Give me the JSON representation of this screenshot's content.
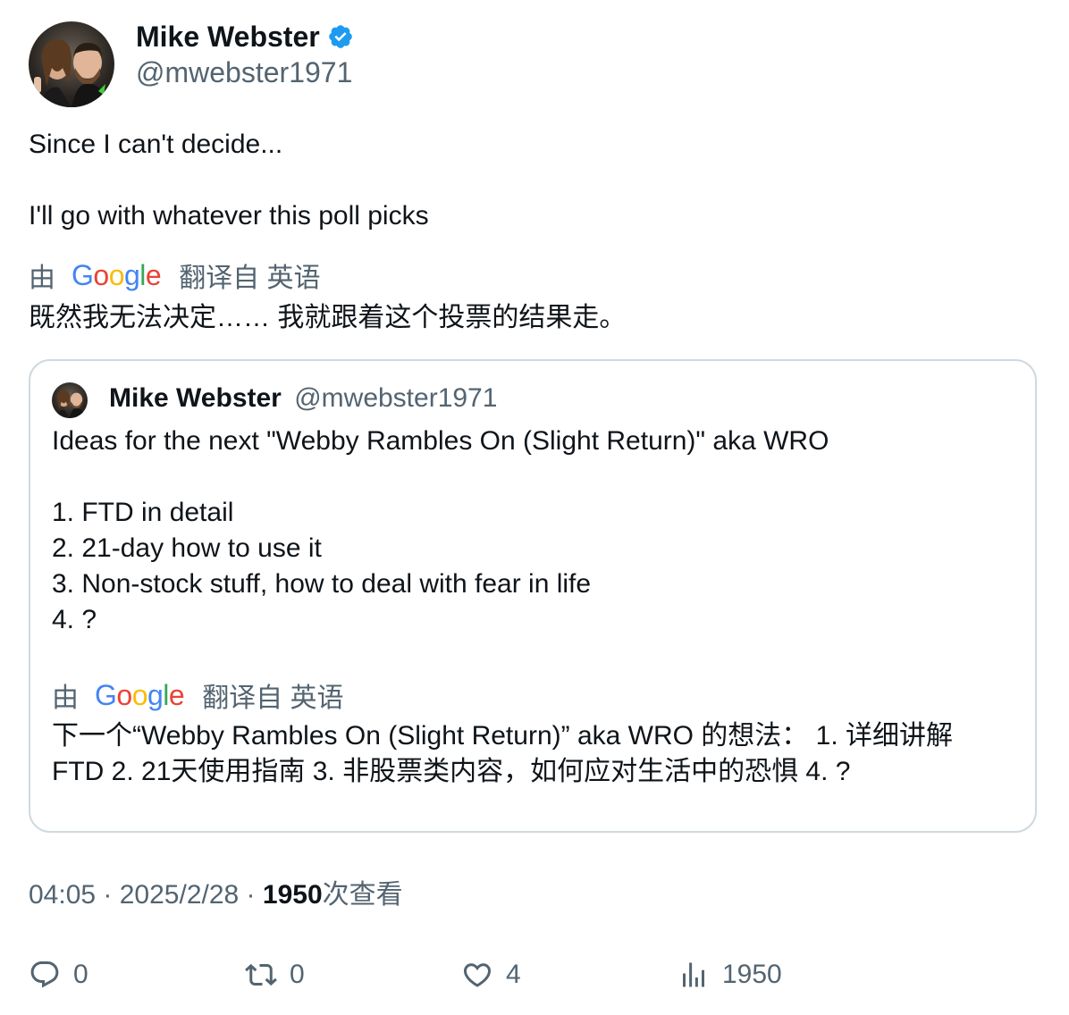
{
  "author": {
    "name": "Mike Webster",
    "handle": "@mwebster1971",
    "verified": true
  },
  "tweet": {
    "line1": "Since I can't decide...",
    "line2": "I'll go with whatever this poll picks",
    "translate_prefix": "由",
    "translate_suffix": "翻译自 英语",
    "translation": "既然我无法决定…… 我就跟着这个投票的结果走。"
  },
  "quote": {
    "name": "Mike Webster",
    "handle": "@mwebster1971",
    "lines": [
      "Ideas for the next \"Webby Rambles On (Slight Return)\" aka WRO",
      "",
      "1. FTD in detail",
      "2. 21-day how to use it",
      "3. Non-stock stuff, how to deal with fear in life",
      "4. ?"
    ],
    "translate_prefix": "由",
    "translate_suffix": "翻译自 英语",
    "translation_line1": "下一个“Webby Rambles On (Slight Return)” aka WRO 的想法： 1. 详细讲解",
    "translation_line2": "FTD 2. 21天使用指南 3. 非股票类内容，如何应对生活中的恐惧 4. ?"
  },
  "meta": {
    "time": "04:05",
    "separator": " · ",
    "date": "2025/2/28",
    "views_count": "1950",
    "views_label": "次查看"
  },
  "actions": {
    "reply_count": "0",
    "retweet_count": "0",
    "like_count": "4",
    "views_count": "1950"
  },
  "colors": {
    "text_primary": "#0f1419",
    "text_secondary": "#536471",
    "border": "#cfd9de",
    "verified_blue": "#1d9bf0"
  },
  "icons": [
    "verified-badge-icon",
    "reply-icon",
    "retweet-icon",
    "like-icon",
    "views-icon"
  ]
}
